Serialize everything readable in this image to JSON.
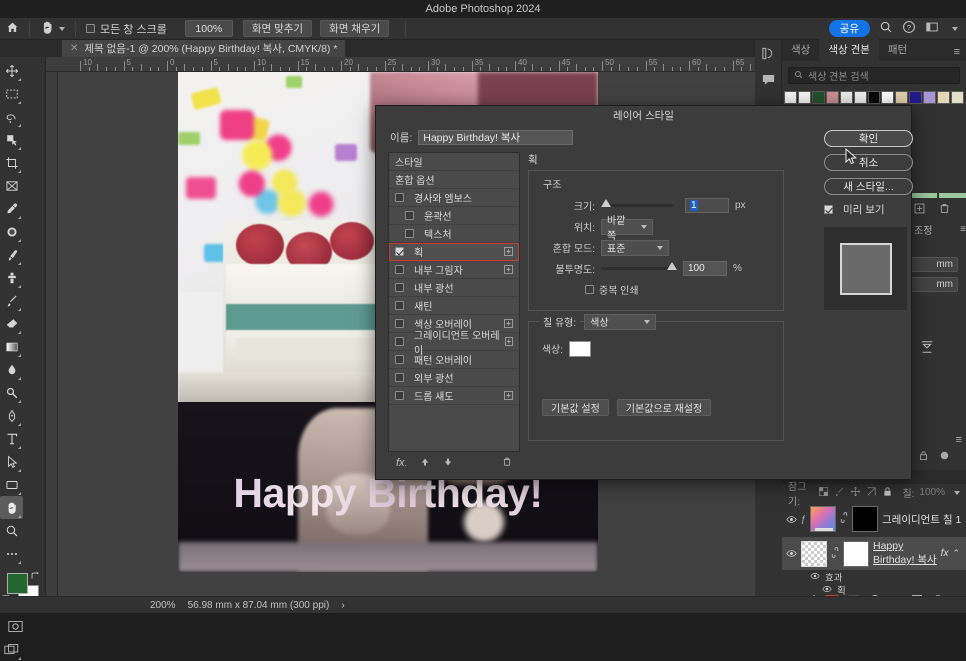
{
  "app": {
    "title": "Adobe Photoshop 2024"
  },
  "options_bar": {
    "home_icon": "home-icon",
    "tool_icon": "hand-tool-icon",
    "scroll_all_label": "모든 창 스크롤",
    "zoom_value": "100%",
    "fit_screen_label": "화면 맞추기",
    "fill_screen_label": "화면 채우기",
    "share_label": "공유",
    "search_icon": "search-icon",
    "help_icon": "help-icon",
    "workspace_icon": "workspace-icon"
  },
  "document_tab": {
    "label": "제목 없음-1 @ 200% (Happy Birthday! 복사, CMYK/8) *",
    "close_icon": "close-icon"
  },
  "toolbar": {
    "tools": [
      "move-tool-icon",
      "marquee-tool-icon",
      "lasso-tool-icon",
      "object-select-tool-icon",
      "crop-tool-icon",
      "frame-tool-icon",
      "eyedropper-tool-icon",
      "healing-brush-tool-icon",
      "brush-tool-icon",
      "clone-stamp-tool-icon",
      "history-brush-tool-icon",
      "eraser-tool-icon",
      "gradient-tool-icon",
      "blur-tool-icon",
      "dodge-tool-icon",
      "pen-tool-icon",
      "type-tool-icon",
      "path-selection-tool-icon",
      "shape-tool-icon",
      "hand-tool-icon",
      "zoom-tool-icon",
      "edit-toolbar-icon"
    ],
    "foreground_color": "#23662e",
    "background_color": "#ffffff",
    "swap_icon": "swap-colors-icon",
    "default_icon": "default-colors-icon",
    "quick_mask_icon": "quick-mask-icon",
    "screen_mode_icon": "screen-mode-icon"
  },
  "ruler": {
    "labels": [
      "10",
      "5",
      "0",
      "5",
      "10",
      "15",
      "20",
      "25",
      "30",
      "35",
      "40",
      "45",
      "50",
      "55",
      "60",
      "65"
    ]
  },
  "canvas": {
    "artwork_text": "Happy Birthday!"
  },
  "right_dock": {
    "rail_icons": [
      "libraries-icon",
      "comments-icon"
    ],
    "color_panel": {
      "tabs": [
        "색상",
        "색상 견본",
        "패턴"
      ],
      "active_tab": "색상 견본",
      "menu_icon": "panel-menu-icon",
      "search_placeholder": "색상 견본 검색",
      "search_icon": "search-icon",
      "swatches": [
        "#f2f2f2",
        "#f7f5f0",
        "#23512c",
        "#c98e8e",
        "#e9e9e7",
        "#efefef",
        "#080808",
        "#fcfcfc",
        "#e3cfae",
        "#221a8e",
        "#a895d4",
        "#e3d6b5",
        "#e6dfc8"
      ]
    },
    "properties_panel": {
      "label_adjust": "조정",
      "menu_icon": "panel-menu-icon",
      "unit_1": "mm",
      "unit_2": "mm",
      "align_icon": "distribute-icon",
      "add_icon": "add-icon",
      "delete_icon": "delete-icon"
    },
    "layers_panel": {
      "lock_label": "잠그기:",
      "fill_label": "칠:",
      "fill_value": "100%",
      "lock_icons": [
        "lock-transparent-icon",
        "lock-image-icon",
        "lock-position-icon",
        "lock-artboard-icon",
        "lock-all-icon"
      ],
      "layers": [
        {
          "name": "그레이디언트 칠 1",
          "eye_icon": "eye-icon",
          "has_mask": true,
          "link_icon": "link-icon"
        },
        {
          "name": "Happy Birthday! 복사",
          "eye_icon": "eye-icon",
          "has_mask": true,
          "link_icon": "link-icon",
          "fx_label": "fx",
          "collapse_icon": "chevron-up-icon"
        }
      ],
      "effects_label": "효과",
      "effect_name": "획",
      "footer_icons": [
        "link-layers-icon",
        "fx-icon",
        "add-mask-icon",
        "adjustment-icon",
        "group-icon",
        "new-layer-icon",
        "delete-layer-icon"
      ],
      "highlighted_footer_icon": "fx-icon"
    }
  },
  "dialog": {
    "title": "레이어 스타일",
    "name_label": "이름:",
    "name_value": "Happy Birthday! 복사",
    "style_list": [
      {
        "label": "스타일",
        "type": "header"
      },
      {
        "label": "혼합 옵션",
        "type": "header"
      },
      {
        "label": "경사와 엠보스",
        "type": "check",
        "checked": false,
        "plus": false
      },
      {
        "label": "윤곽선",
        "type": "check",
        "checked": false,
        "indent": true,
        "plus": false
      },
      {
        "label": "텍스처",
        "type": "check",
        "checked": false,
        "indent": true,
        "plus": false
      },
      {
        "label": "획",
        "type": "check",
        "checked": true,
        "plus": true,
        "highlighted": true
      },
      {
        "label": "내부 그림자",
        "type": "check",
        "checked": false,
        "plus": true
      },
      {
        "label": "내부 광선",
        "type": "check",
        "checked": false,
        "plus": false
      },
      {
        "label": "새틴",
        "type": "check",
        "checked": false,
        "plus": false
      },
      {
        "label": "색상 오버레이",
        "type": "check",
        "checked": false,
        "plus": true
      },
      {
        "label": "그레이디언트 오버레이",
        "type": "check",
        "checked": false,
        "plus": true
      },
      {
        "label": "패턴 오버레이",
        "type": "check",
        "checked": false,
        "plus": false
      },
      {
        "label": "외부 광선",
        "type": "check",
        "checked": false,
        "plus": false
      },
      {
        "label": "드롭 섀도",
        "type": "check",
        "checked": false,
        "plus": true
      }
    ],
    "style_footer_icons": [
      "fx-icon",
      "move-up-icon",
      "move-down-icon",
      "delete-icon"
    ],
    "settings": {
      "section_title": "획",
      "structure_title": "구조",
      "size_label": "크기:",
      "size_value": "1",
      "size_unit": "px",
      "position_label": "위치:",
      "position_value": "바깥쪽",
      "blend_mode_label": "혼합 모드:",
      "blend_mode_value": "표준",
      "opacity_label": "불투명도:",
      "opacity_value": "100",
      "opacity_unit": "%",
      "overprint_label": "중복 인쇄",
      "overprint_checked": false,
      "fill_type_label": "칠 유형:",
      "fill_type_value": "색상",
      "color_label": "색상:",
      "color_value": "#ffffff",
      "set_default_label": "기본값 설정",
      "reset_default_label": "기본값으로 재설정"
    },
    "buttons": {
      "ok": "확인",
      "cancel": "취소",
      "new_style": "새 스타일...",
      "preview_label": "미리 보기",
      "preview_checked": true
    }
  },
  "status_bar": {
    "zoom": "200%",
    "dimensions": "56.98 mm x 87.04 mm (300 ppi)",
    "arrow": "›"
  }
}
